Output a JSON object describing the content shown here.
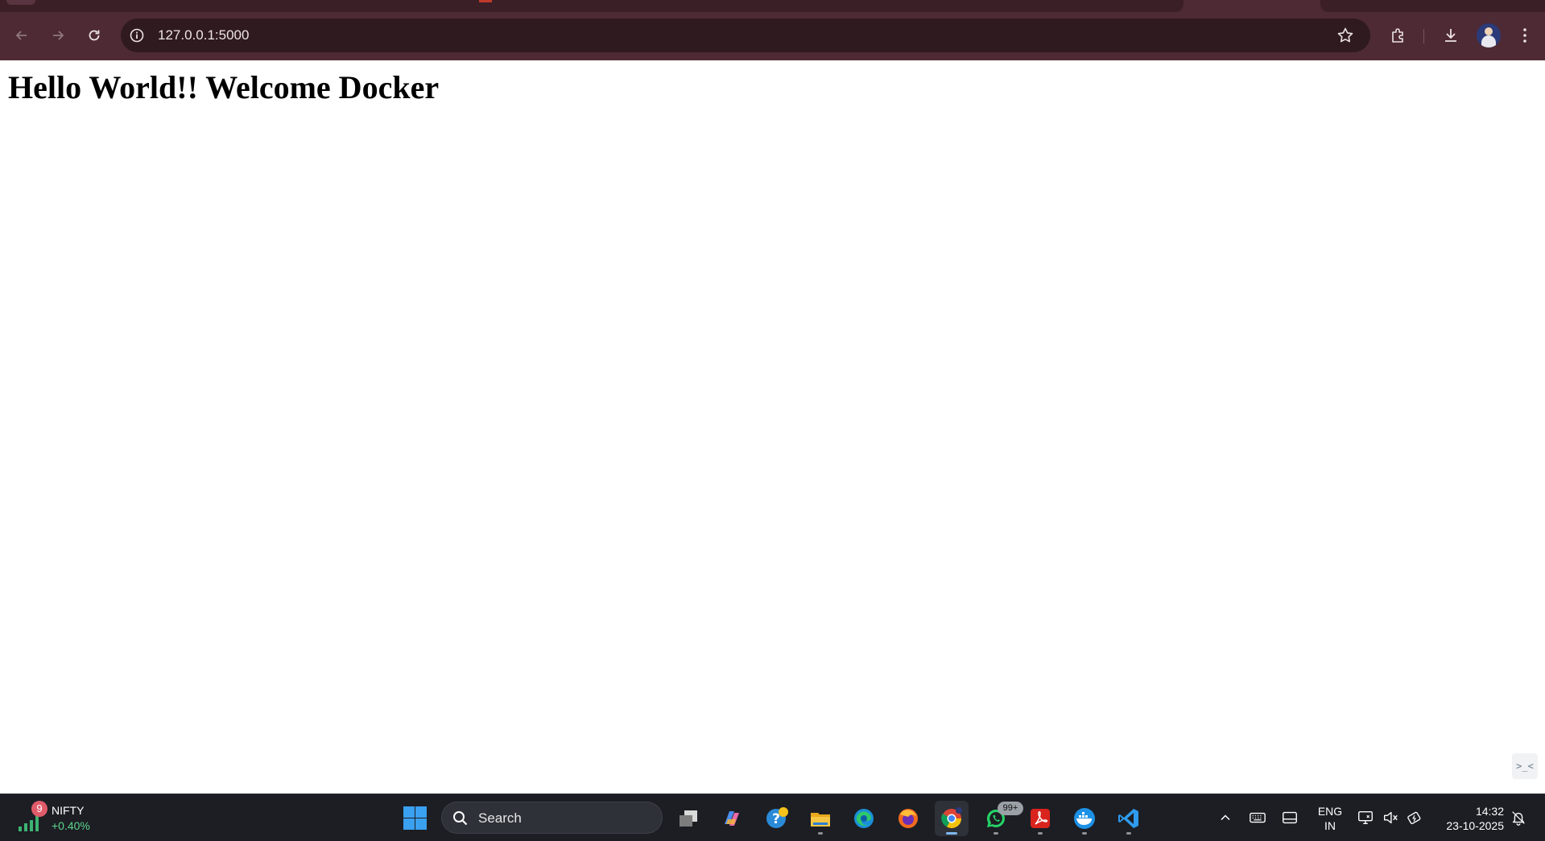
{
  "browser": {
    "url": "127.0.0.1:5000",
    "colors": {
      "frame": "#4e2a35",
      "omnibox": "#2f1a20"
    },
    "icons": {
      "back": "back-arrow-icon",
      "forward": "forward-arrow-icon",
      "reload": "reload-icon",
      "site_info": "site-info-icon",
      "bookmark": "star-icon",
      "extensions": "extensions-puzzle-icon",
      "downloads": "download-icon",
      "profile": "profile-avatar",
      "menu": "kebab-menu-icon"
    }
  },
  "page": {
    "heading": "Hello World!! Welcome Docker"
  },
  "taskbar": {
    "widget": {
      "notification_count": "9",
      "name": "NIFTY",
      "change": "+0.40%"
    },
    "search_placeholder": "Search",
    "apps": [
      {
        "name": "task-view-icon"
      },
      {
        "name": "copilot-icon"
      },
      {
        "name": "get-help-icon"
      },
      {
        "name": "file-explorer-icon"
      },
      {
        "name": "edge-icon"
      },
      {
        "name": "firefox-icon"
      },
      {
        "name": "chrome-icon",
        "active": true
      },
      {
        "name": "whatsapp-icon",
        "badge": "99+"
      },
      {
        "name": "acrobat-icon"
      },
      {
        "name": "docker-icon"
      },
      {
        "name": "vscode-icon"
      }
    ],
    "tray": {
      "language_line1": "ENG",
      "language_line2": "IN",
      "time": "14:32",
      "date": "23-10-2025"
    }
  }
}
